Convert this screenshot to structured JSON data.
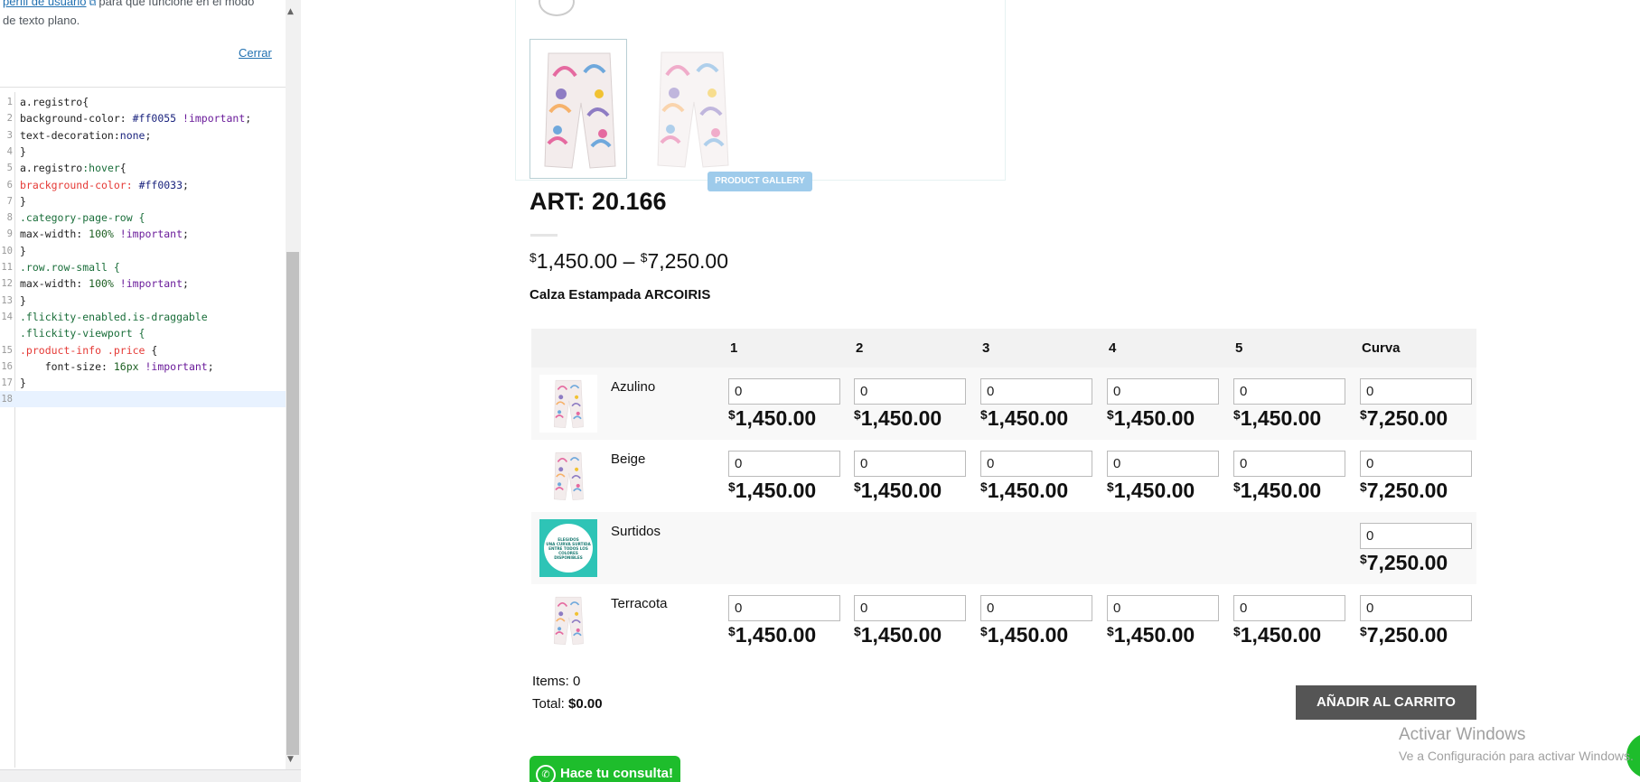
{
  "panel": {
    "note_link": "perfil de usuario",
    "note_text_1": "para que funcione en el modo",
    "note_text_2": "de texto plano.",
    "close_label": "Cerrar",
    "code_lines": [
      {
        "n": "1",
        "tokens": [
          {
            "t": "a.registro{",
            "c": "tok-sel"
          }
        ]
      },
      {
        "n": "2",
        "tokens": [
          {
            "t": "background-color: ",
            "c": "tok-prop"
          },
          {
            "t": "#ff0055",
            "c": "tok-val"
          },
          {
            "t": " !important",
            "c": "tok-imp"
          },
          {
            "t": ";",
            "c": "tok-prop"
          }
        ]
      },
      {
        "n": "3",
        "tokens": [
          {
            "t": "text-decoration:",
            "c": "tok-prop"
          },
          {
            "t": "none",
            "c": "tok-val"
          },
          {
            "t": ";",
            "c": "tok-prop"
          }
        ]
      },
      {
        "n": "4",
        "tokens": [
          {
            "t": "}",
            "c": "tok-sel"
          }
        ]
      },
      {
        "n": "5",
        "tokens": [
          {
            "t": "a.registro",
            "c": "tok-sel"
          },
          {
            "t": ":hover",
            "c": "tok-key"
          },
          {
            "t": "{",
            "c": "tok-sel"
          }
        ]
      },
      {
        "n": "6",
        "tokens": [
          {
            "t": "brackground-color: ",
            "c": "tok-err"
          },
          {
            "t": "#ff0033",
            "c": "tok-val"
          },
          {
            "t": ";",
            "c": "tok-prop"
          }
        ]
      },
      {
        "n": "7",
        "tokens": [
          {
            "t": "}",
            "c": "tok-sel"
          }
        ]
      },
      {
        "n": "8",
        "tokens": [
          {
            "t": ".category-page-row {",
            "c": "tok-key"
          }
        ]
      },
      {
        "n": "9",
        "tokens": [
          {
            "t": "max-width: ",
            "c": "tok-prop"
          },
          {
            "t": "100%",
            "c": "tok-num"
          },
          {
            "t": " !important",
            "c": "tok-imp"
          },
          {
            "t": ";",
            "c": "tok-prop"
          }
        ]
      },
      {
        "n": "10",
        "tokens": [
          {
            "t": "}",
            "c": "tok-sel"
          }
        ]
      },
      {
        "n": "11",
        "tokens": [
          {
            "t": ".row.row-small {",
            "c": "tok-key"
          }
        ]
      },
      {
        "n": "12",
        "tokens": [
          {
            "t": "max-width: ",
            "c": "tok-prop"
          },
          {
            "t": "100%",
            "c": "tok-num"
          },
          {
            "t": " !important",
            "c": "tok-imp"
          },
          {
            "t": ";",
            "c": "tok-prop"
          }
        ]
      },
      {
        "n": "13",
        "tokens": [
          {
            "t": "}",
            "c": "tok-sel"
          }
        ]
      },
      {
        "n": "14",
        "tokens": [
          {
            "t": ".flickity-enabled.is-draggable",
            "c": "tok-key"
          }
        ]
      },
      {
        "n": "",
        "tokens": [
          {
            "t": ".flickity-viewport {",
            "c": "tok-key"
          }
        ]
      },
      {
        "n": "15",
        "tokens": [
          {
            "t": ".product-info .price",
            "c": "tok-err"
          },
          {
            "t": " {",
            "c": "tok-sel"
          }
        ]
      },
      {
        "n": "16",
        "tokens": [
          {
            "t": "    font-size: ",
            "c": "tok-prop"
          },
          {
            "t": "16px",
            "c": "tok-num"
          },
          {
            "t": " !important",
            "c": "tok-imp"
          },
          {
            "t": ";",
            "c": "tok-prop"
          }
        ]
      },
      {
        "n": "17",
        "tokens": [
          {
            "t": "}",
            "c": "tok-sel"
          }
        ]
      },
      {
        "n": "18",
        "tokens": [
          {
            "t": "",
            "c": "tok-sel"
          }
        ]
      }
    ]
  },
  "product": {
    "gallery_badge": "PRODUCT GALLERY",
    "title": "ART: 20.166",
    "price_from_symbol": "$",
    "price_from": "1,450.00",
    "price_sep": " – ",
    "price_to_symbol": "$",
    "price_to": "7,250.00",
    "short_description": "Calza Estampada ARCOIRIS"
  },
  "table": {
    "headers": [
      "1",
      "2",
      "3",
      "4",
      "5",
      "Curva"
    ],
    "rows": [
      {
        "name": "Azulino",
        "image": "pants",
        "quantities": [
          "0",
          "0",
          "0",
          "0",
          "0",
          "0"
        ],
        "prices": [
          "1,450.00",
          "1,450.00",
          "1,450.00",
          "1,450.00",
          "1,450.00",
          "7,250.00"
        ]
      },
      {
        "name": "Beige",
        "image": "pants",
        "quantities": [
          "0",
          "0",
          "0",
          "0",
          "0",
          "0"
        ],
        "prices": [
          "1,450.00",
          "1,450.00",
          "1,450.00",
          "1,450.00",
          "1,450.00",
          "7,250.00"
        ]
      },
      {
        "name": "Surtidos",
        "image": "badge",
        "badge_text": [
          "ELEGIDOS",
          "UNA CURVA SURTIDA",
          "ENTRE TODOS LOS",
          "COLORES",
          "DISPONIBLES"
        ],
        "quantities": [
          null,
          null,
          null,
          null,
          null,
          "0"
        ],
        "prices": [
          null,
          null,
          null,
          null,
          null,
          "7,250.00"
        ]
      },
      {
        "name": "Terracota",
        "image": "pants",
        "quantities": [
          "0",
          "0",
          "0",
          "0",
          "0",
          "0"
        ],
        "prices": [
          "1,450.00",
          "1,450.00",
          "1,450.00",
          "1,450.00",
          "1,450.00",
          "7,250.00"
        ]
      }
    ],
    "currency_symbol": "$"
  },
  "cart": {
    "items_label": "Items: 0",
    "total_label": "Total: ",
    "total_value": "$0.00",
    "add_button": "AÑADIR AL CARRITO"
  },
  "consult_button": "Hace tu consulta!",
  "watermark": {
    "line1": "Activar Windows",
    "line2": "Ve a Configuración para activar Windows."
  },
  "colors": {
    "accent_green": "#1ebd2c",
    "button_dark": "#555555",
    "badge_blue": "#9ecbeb",
    "link_blue": "#2271b1"
  }
}
